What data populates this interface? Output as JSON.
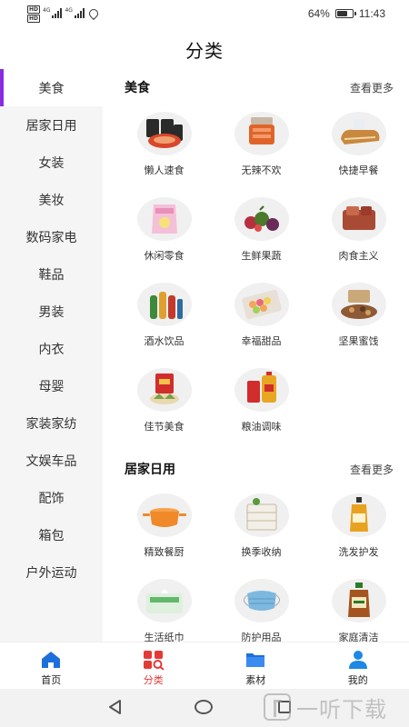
{
  "status_bar": {
    "left_badges": [
      "HD",
      "HD"
    ],
    "network": [
      "4G",
      "4G"
    ],
    "battery": "64%",
    "time": "11:43"
  },
  "page": {
    "title": "分类"
  },
  "sidebar": {
    "active_index": 0,
    "items": [
      {
        "label": "美食"
      },
      {
        "label": "居家日用"
      },
      {
        "label": "女装"
      },
      {
        "label": "美妆"
      },
      {
        "label": "数码家电"
      },
      {
        "label": "鞋品"
      },
      {
        "label": "男装"
      },
      {
        "label": "内衣"
      },
      {
        "label": "母婴"
      },
      {
        "label": "家装家纺"
      },
      {
        "label": "文娱车品"
      },
      {
        "label": "配饰"
      },
      {
        "label": "箱包"
      },
      {
        "label": "户外运动"
      }
    ]
  },
  "sections": [
    {
      "title": "美食",
      "more": "查看更多",
      "items": [
        {
          "label": "懒人速食",
          "icon": "instant-food-icon",
          "color": "#d9472b"
        },
        {
          "label": "无辣不欢",
          "icon": "spicy-meat-icon",
          "color": "#e0642a"
        },
        {
          "label": "快捷早餐",
          "icon": "bread-icon",
          "color": "#c8893e"
        },
        {
          "label": "休闲零食",
          "icon": "snack-bag-icon",
          "color": "#e98fb8"
        },
        {
          "label": "生鲜果蔬",
          "icon": "fruit-vegetable-icon",
          "color": "#b7303f"
        },
        {
          "label": "肉食主义",
          "icon": "meat-box-icon",
          "color": "#9c3b2a"
        },
        {
          "label": "酒水饮品",
          "icon": "drinks-icon",
          "color": "#3f8a3a"
        },
        {
          "label": "幸福甜品",
          "icon": "macaron-icon",
          "color": "#f2a65a"
        },
        {
          "label": "坚果蜜饯",
          "icon": "nuts-icon",
          "color": "#8d5a35"
        },
        {
          "label": "佳节美食",
          "icon": "festival-food-icon",
          "color": "#d12d2d"
        },
        {
          "label": "粮油调味",
          "icon": "cooking-oil-icon",
          "color": "#e8a623"
        }
      ]
    },
    {
      "title": "居家日用",
      "more": "查看更多",
      "items": [
        {
          "label": "精致餐厨",
          "icon": "pot-icon",
          "color": "#f0892a"
        },
        {
          "label": "换季收纳",
          "icon": "storage-drawer-icon",
          "color": "#c9b79a"
        },
        {
          "label": "洗发护发",
          "icon": "shampoo-icon",
          "color": "#e9a21f"
        },
        {
          "label": "生活纸巾",
          "icon": "tissue-icon",
          "color": "#62b86a"
        },
        {
          "label": "防护用品",
          "icon": "face-mask-icon",
          "color": "#7db8df"
        },
        {
          "label": "家庭清洁",
          "icon": "disinfectant-icon",
          "color": "#a4551f"
        }
      ]
    }
  ],
  "bottom_nav": {
    "active_index": 1,
    "items": [
      {
        "label": "首页",
        "icon": "home-icon",
        "color": "#1e6fd9"
      },
      {
        "label": "分类",
        "icon": "category-icon",
        "color": "#e53935"
      },
      {
        "label": "素材",
        "icon": "folder-icon",
        "color": "#1e6fd9"
      },
      {
        "label": "我的",
        "icon": "user-icon",
        "color": "#1e88e5"
      }
    ]
  },
  "watermark": {
    "text": "一听下载"
  }
}
